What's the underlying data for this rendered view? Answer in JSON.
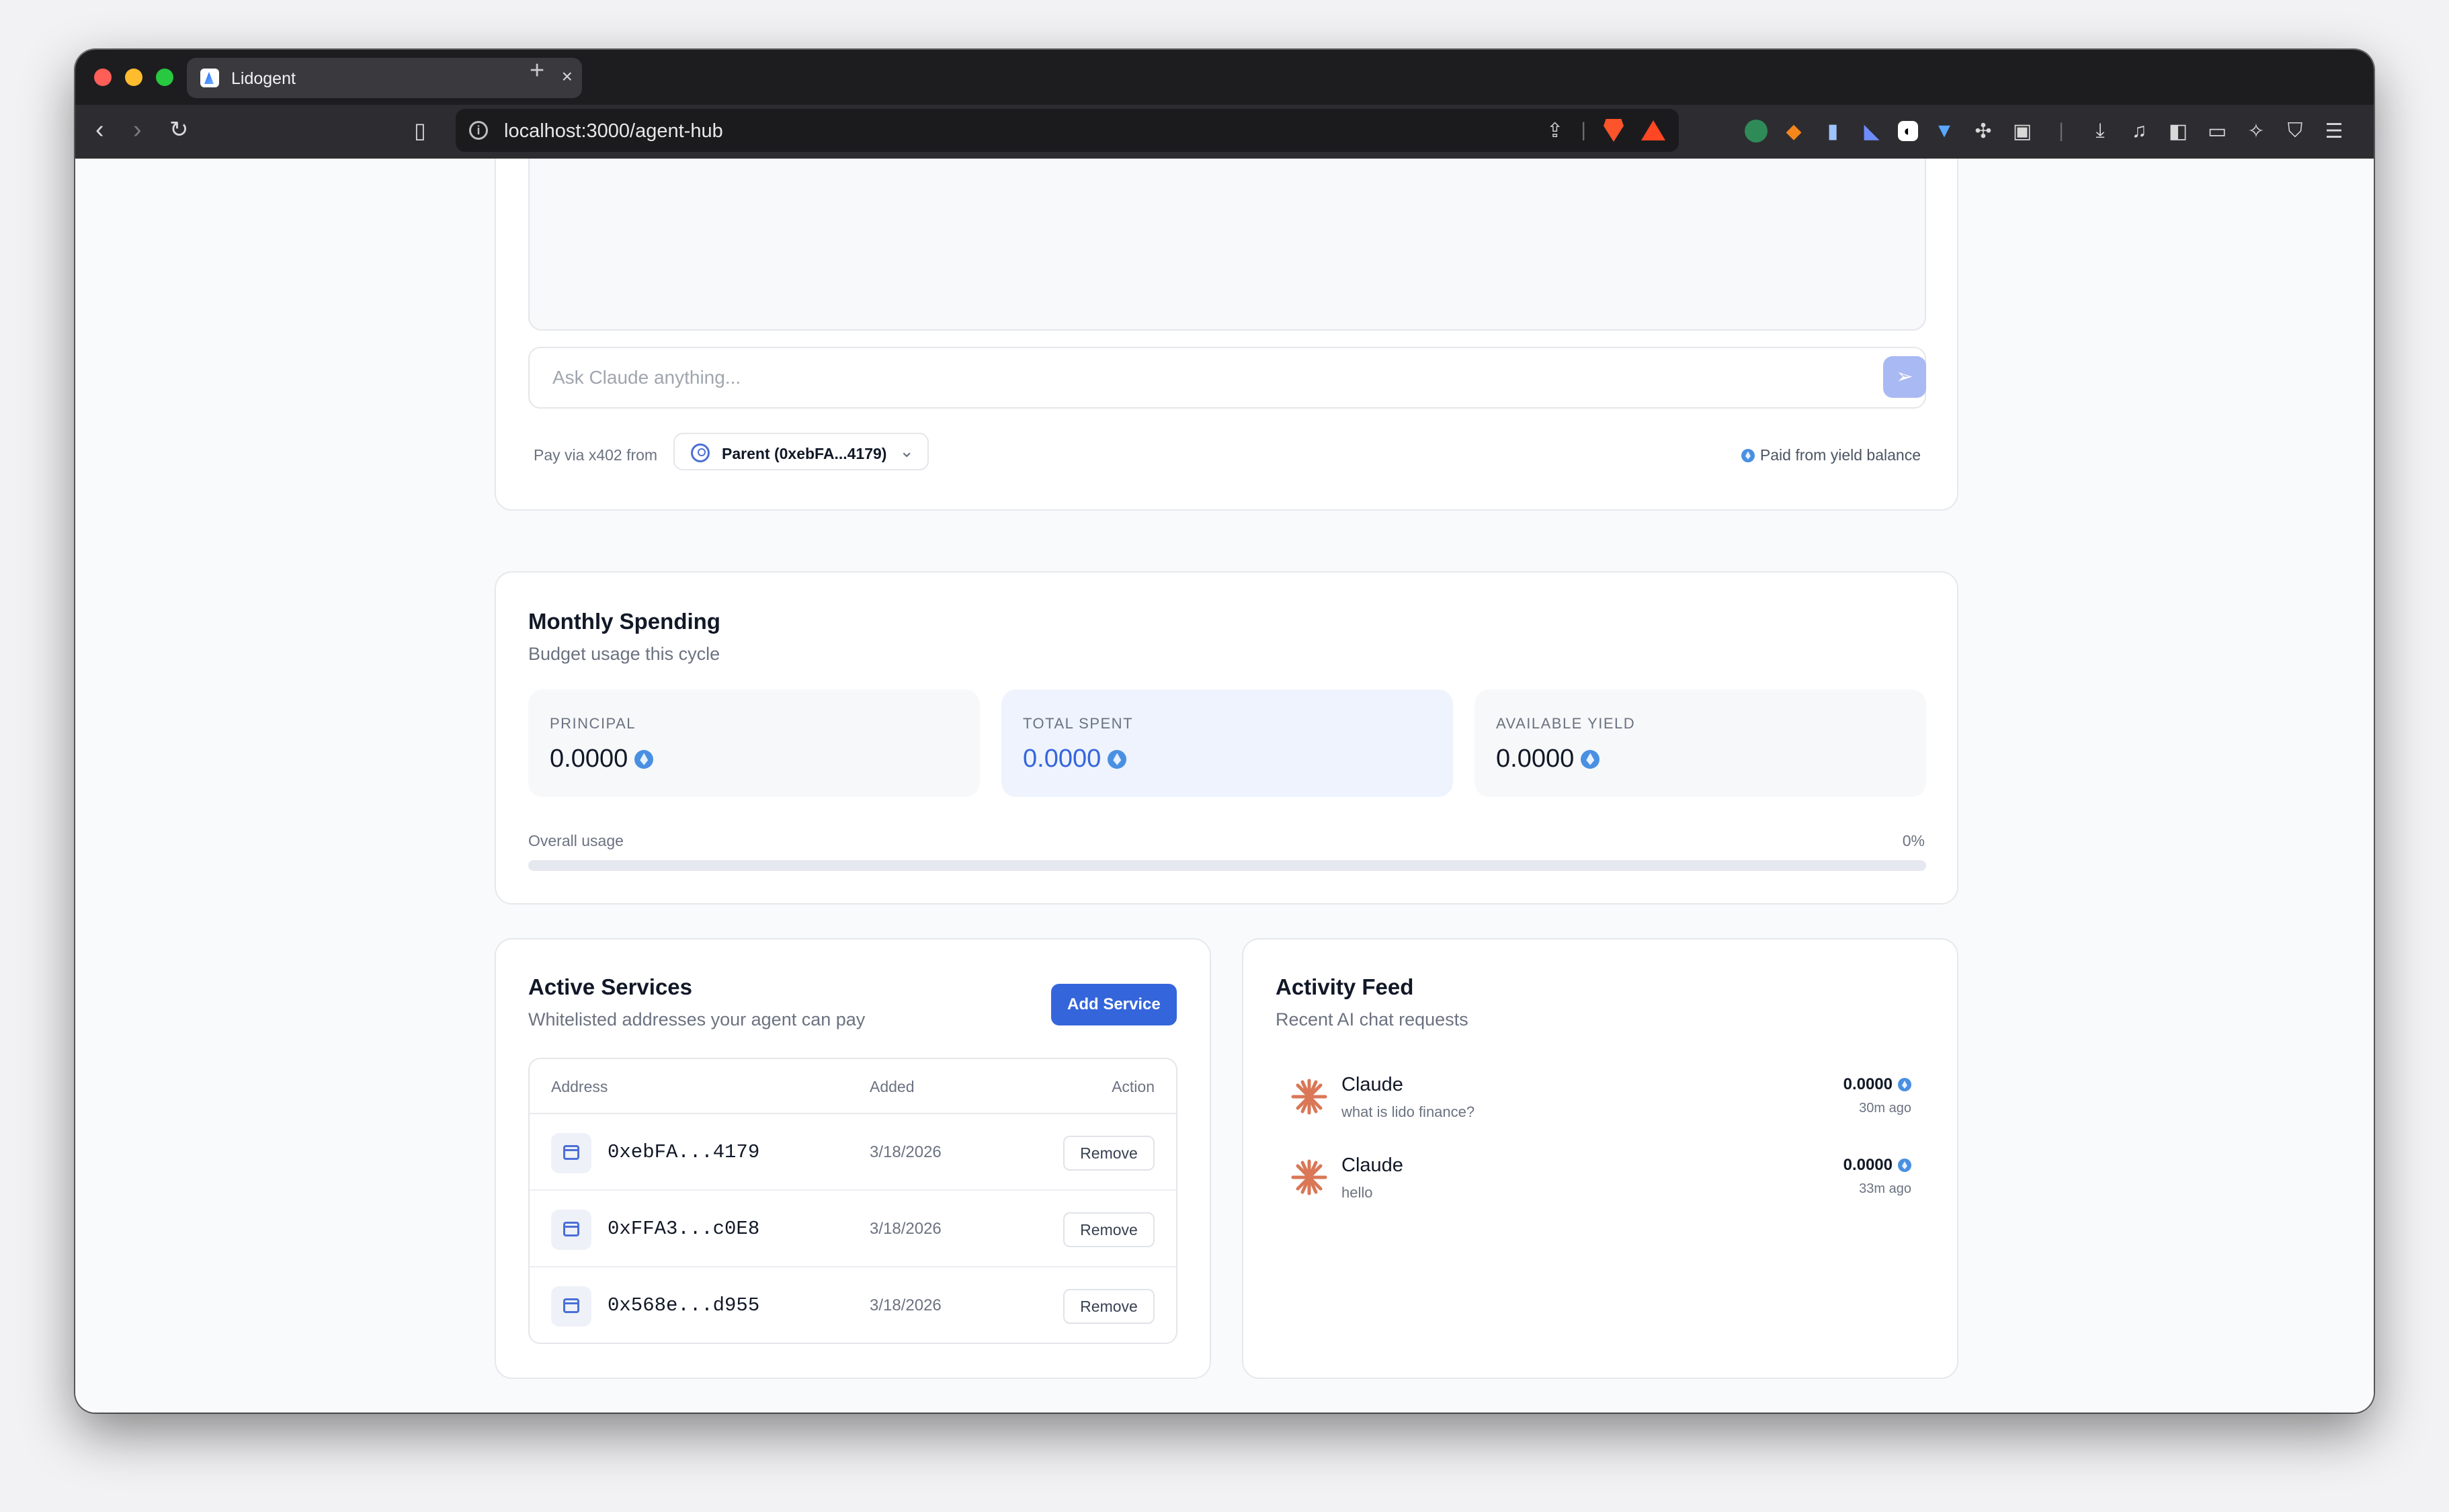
{
  "browser": {
    "tab_title": "Lidogent",
    "tab_close": "×",
    "new_tab": "+",
    "url": "localhost:3000/agent-hub"
  },
  "chat": {
    "input_placeholder": "Ask Claude anything...",
    "pay_label": "Pay via x402 from",
    "pay_source": "Parent (0xebFA...4179)",
    "paid_note": "Paid from yield balance"
  },
  "spending": {
    "title": "Monthly Spending",
    "subtitle": "Budget usage this cycle",
    "stats": [
      {
        "label": "PRINCIPAL",
        "value": "0.0000"
      },
      {
        "label": "TOTAL SPENT",
        "value": "0.0000"
      },
      {
        "label": "AVAILABLE YIELD",
        "value": "0.0000"
      }
    ],
    "usage_label": "Overall usage",
    "usage_percent": "0%",
    "usage_fraction": 0
  },
  "services": {
    "title": "Active Services",
    "subtitle": "Whitelisted addresses your agent can pay",
    "add_button": "Add Service",
    "columns": [
      "Address",
      "Added",
      "Action"
    ],
    "rows": [
      {
        "address": "0xebFA...4179",
        "added": "3/18/2026",
        "action": "Remove"
      },
      {
        "address": "0xFFA3...c0E8",
        "added": "3/18/2026",
        "action": "Remove"
      },
      {
        "address": "0x568e...d955",
        "added": "3/18/2026",
        "action": "Remove"
      }
    ]
  },
  "activity": {
    "title": "Activity Feed",
    "subtitle": "Recent AI chat requests",
    "items": [
      {
        "name": "Claude",
        "message": "what is lido finance?",
        "amount": "0.0000",
        "time": "30m ago"
      },
      {
        "name": "Claude",
        "message": "hello",
        "amount": "0.0000",
        "time": "33m ago"
      }
    ]
  },
  "colors": {
    "accent": "#3565db",
    "claude_logo": "#d97757"
  }
}
